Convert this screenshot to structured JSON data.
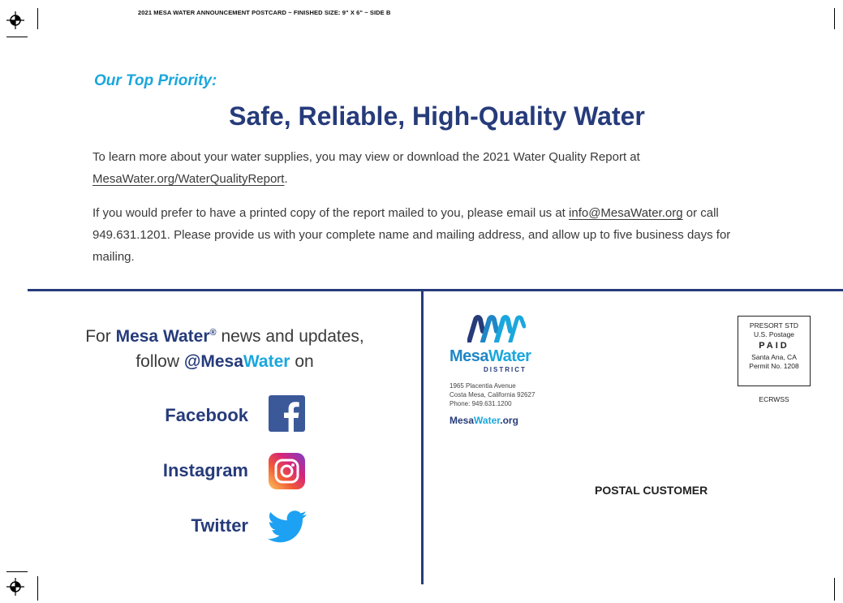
{
  "header": {
    "slug": "2021 MESA WATER ANNOUNCEMENT POSTCARD  ~  FINISHED SIZE: 9\" X 6\"  ~  SIDE B"
  },
  "intro": {
    "priority": "Our Top Priority:",
    "headline": "Safe, Reliable, High-Quality Water",
    "p1_text": "To learn more about your water supplies, you may view or download the 2021 Water Quality Report at",
    "p1_link": "MesaWater.org/WaterQualityReport",
    "p1_end": ".",
    "p2_text": "If you would prefer to have a printed copy of the report mailed to you, please email us at",
    "p2_link": "info@MesaWater.org",
    "p2_rest": "or call 949.631.1201. Please provide us with your complete name and mailing address, and allow up to five business days for mailing."
  },
  "social": {
    "line1_prefix": "For",
    "brand": "Mesa Water",
    "registered": "®",
    "line1_suffix": "news and updates,",
    "line2_prefix": "follow",
    "handle_at_mesa": "@Mesa",
    "handle_water": "Water",
    "line2_suffix": "on",
    "items": [
      {
        "label": "Facebook",
        "icon": "facebook-icon"
      },
      {
        "label": "Instagram",
        "icon": "instagram-icon"
      },
      {
        "label": "Twitter",
        "icon": "twitter-icon"
      }
    ]
  },
  "mailing": {
    "logo_mesa": "Mesa",
    "logo_water": "Water",
    "logo_district": "DISTRICT",
    "address_line1": "1965 Placentia Avenue",
    "address_line2": "Costa Mesa, California 92627",
    "phone": "Phone: 949.631.1200",
    "site_mesa": "Mesa",
    "site_water": "Water",
    "site_org": ".org",
    "permit": {
      "line1": "PRESORT STD",
      "line2": "U.S. Postage",
      "line3": "PAID",
      "line4": "Santa Ana, CA",
      "line5": "Permit No. 1208"
    },
    "ecrwss": "ECRWSS",
    "recipient": "POSTAL CUSTOMER"
  },
  "colors": {
    "navy": "#263b7a",
    "cyan": "#1aa7dd",
    "facebook": "#3b5998",
    "twitter": "#1da1f2"
  }
}
